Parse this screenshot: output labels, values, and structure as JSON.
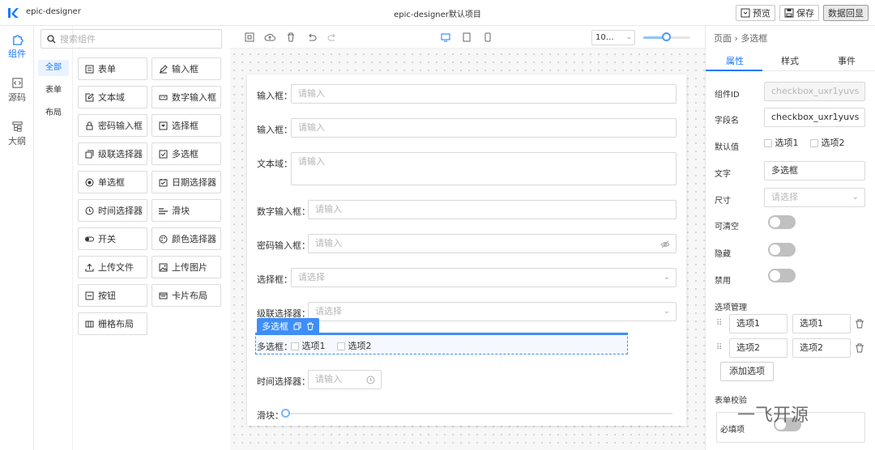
{
  "app": {
    "name": "epic-designer",
    "title": "epic-designer默认项目"
  },
  "header": {
    "preview": "预览",
    "save": "保存",
    "echo": "数据回显"
  },
  "leftnav": [
    {
      "label": "组件",
      "icon": "puzzle-icon"
    },
    {
      "label": "源码",
      "icon": "code-icon"
    },
    {
      "label": "大纲",
      "icon": "outline-icon"
    }
  ],
  "categories": [
    "全部",
    "表单",
    "布局"
  ],
  "search": {
    "placeholder": "搜索组件"
  },
  "components": [
    {
      "label": "表单",
      "icon": "form-icon"
    },
    {
      "label": "输入框",
      "icon": "pen-icon"
    },
    {
      "label": "文本域",
      "icon": "edit-icon"
    },
    {
      "label": "数字输入框",
      "icon": "number-icon"
    },
    {
      "label": "密码输入框",
      "icon": "lock-icon"
    },
    {
      "label": "选择框",
      "icon": "select-icon"
    },
    {
      "label": "级联选择器",
      "icon": "cascade-icon"
    },
    {
      "label": "多选框",
      "icon": "checkbox-icon"
    },
    {
      "label": "单选框",
      "icon": "radio-icon"
    },
    {
      "label": "日期选择器",
      "icon": "calendar-icon"
    },
    {
      "label": "时间选择器",
      "icon": "clock-icon"
    },
    {
      "label": "滑块",
      "icon": "slider-icon"
    },
    {
      "label": "开关",
      "icon": "switch-icon"
    },
    {
      "label": "颜色选择器",
      "icon": "palette-icon"
    },
    {
      "label": "上传文件",
      "icon": "upload-icon"
    },
    {
      "label": "上传图片",
      "icon": "image-icon"
    },
    {
      "label": "按钮",
      "icon": "button-icon"
    },
    {
      "label": "卡片布局",
      "icon": "card-icon"
    },
    {
      "label": "栅格布局",
      "icon": "grid-icon"
    }
  ],
  "canvas": {
    "zoom": "10…"
  },
  "form": {
    "fields": [
      {
        "label": "输入框：",
        "placeholder": "请输入"
      },
      {
        "label": "输入框：",
        "placeholder": "请输入"
      },
      {
        "label": "文本域：",
        "placeholder": "请输入"
      },
      {
        "label": "数字输入框：",
        "placeholder": "请输入"
      },
      {
        "label": "密码输入框：",
        "placeholder": "请输入"
      },
      {
        "label": "选择框：",
        "placeholder": "请选择"
      },
      {
        "label": "级联选择器：",
        "placeholder": "请选择"
      },
      {
        "label": "多选框：",
        "options": [
          "选项1",
          "选项2"
        ]
      },
      {
        "label": "时间选择器：",
        "placeholder": "请输入"
      },
      {
        "label": "滑块："
      }
    ],
    "selected_tag": "多选框"
  },
  "rpanel": {
    "crumb_root": "页面",
    "crumb_sep": "›",
    "crumb_current": "多选框",
    "tabs": [
      "属性",
      "样式",
      "事件"
    ],
    "props": {
      "id_label": "组件ID",
      "id_value": "checkbox_uxr1yuvs",
      "field_label": "字段名",
      "field_value": "checkbox_uxr1yuvs",
      "default_label": "默认值",
      "default_options": [
        "选项1",
        "选项2"
      ],
      "text_label": "文字",
      "text_value": "多选框",
      "size_label": "尺寸",
      "size_placeholder": "请选择",
      "clearable_label": "可清空",
      "hidden_label": "隐藏",
      "disabled_label": "禁用",
      "options_label": "选项管理",
      "options": [
        {
          "label": "选项1",
          "value": "选项1"
        },
        {
          "label": "选项2",
          "value": "选项2"
        }
      ],
      "add_option": "添加选项",
      "rules_label": "表单校验",
      "required_label": "必填项"
    }
  },
  "watermark": "一飞开源"
}
